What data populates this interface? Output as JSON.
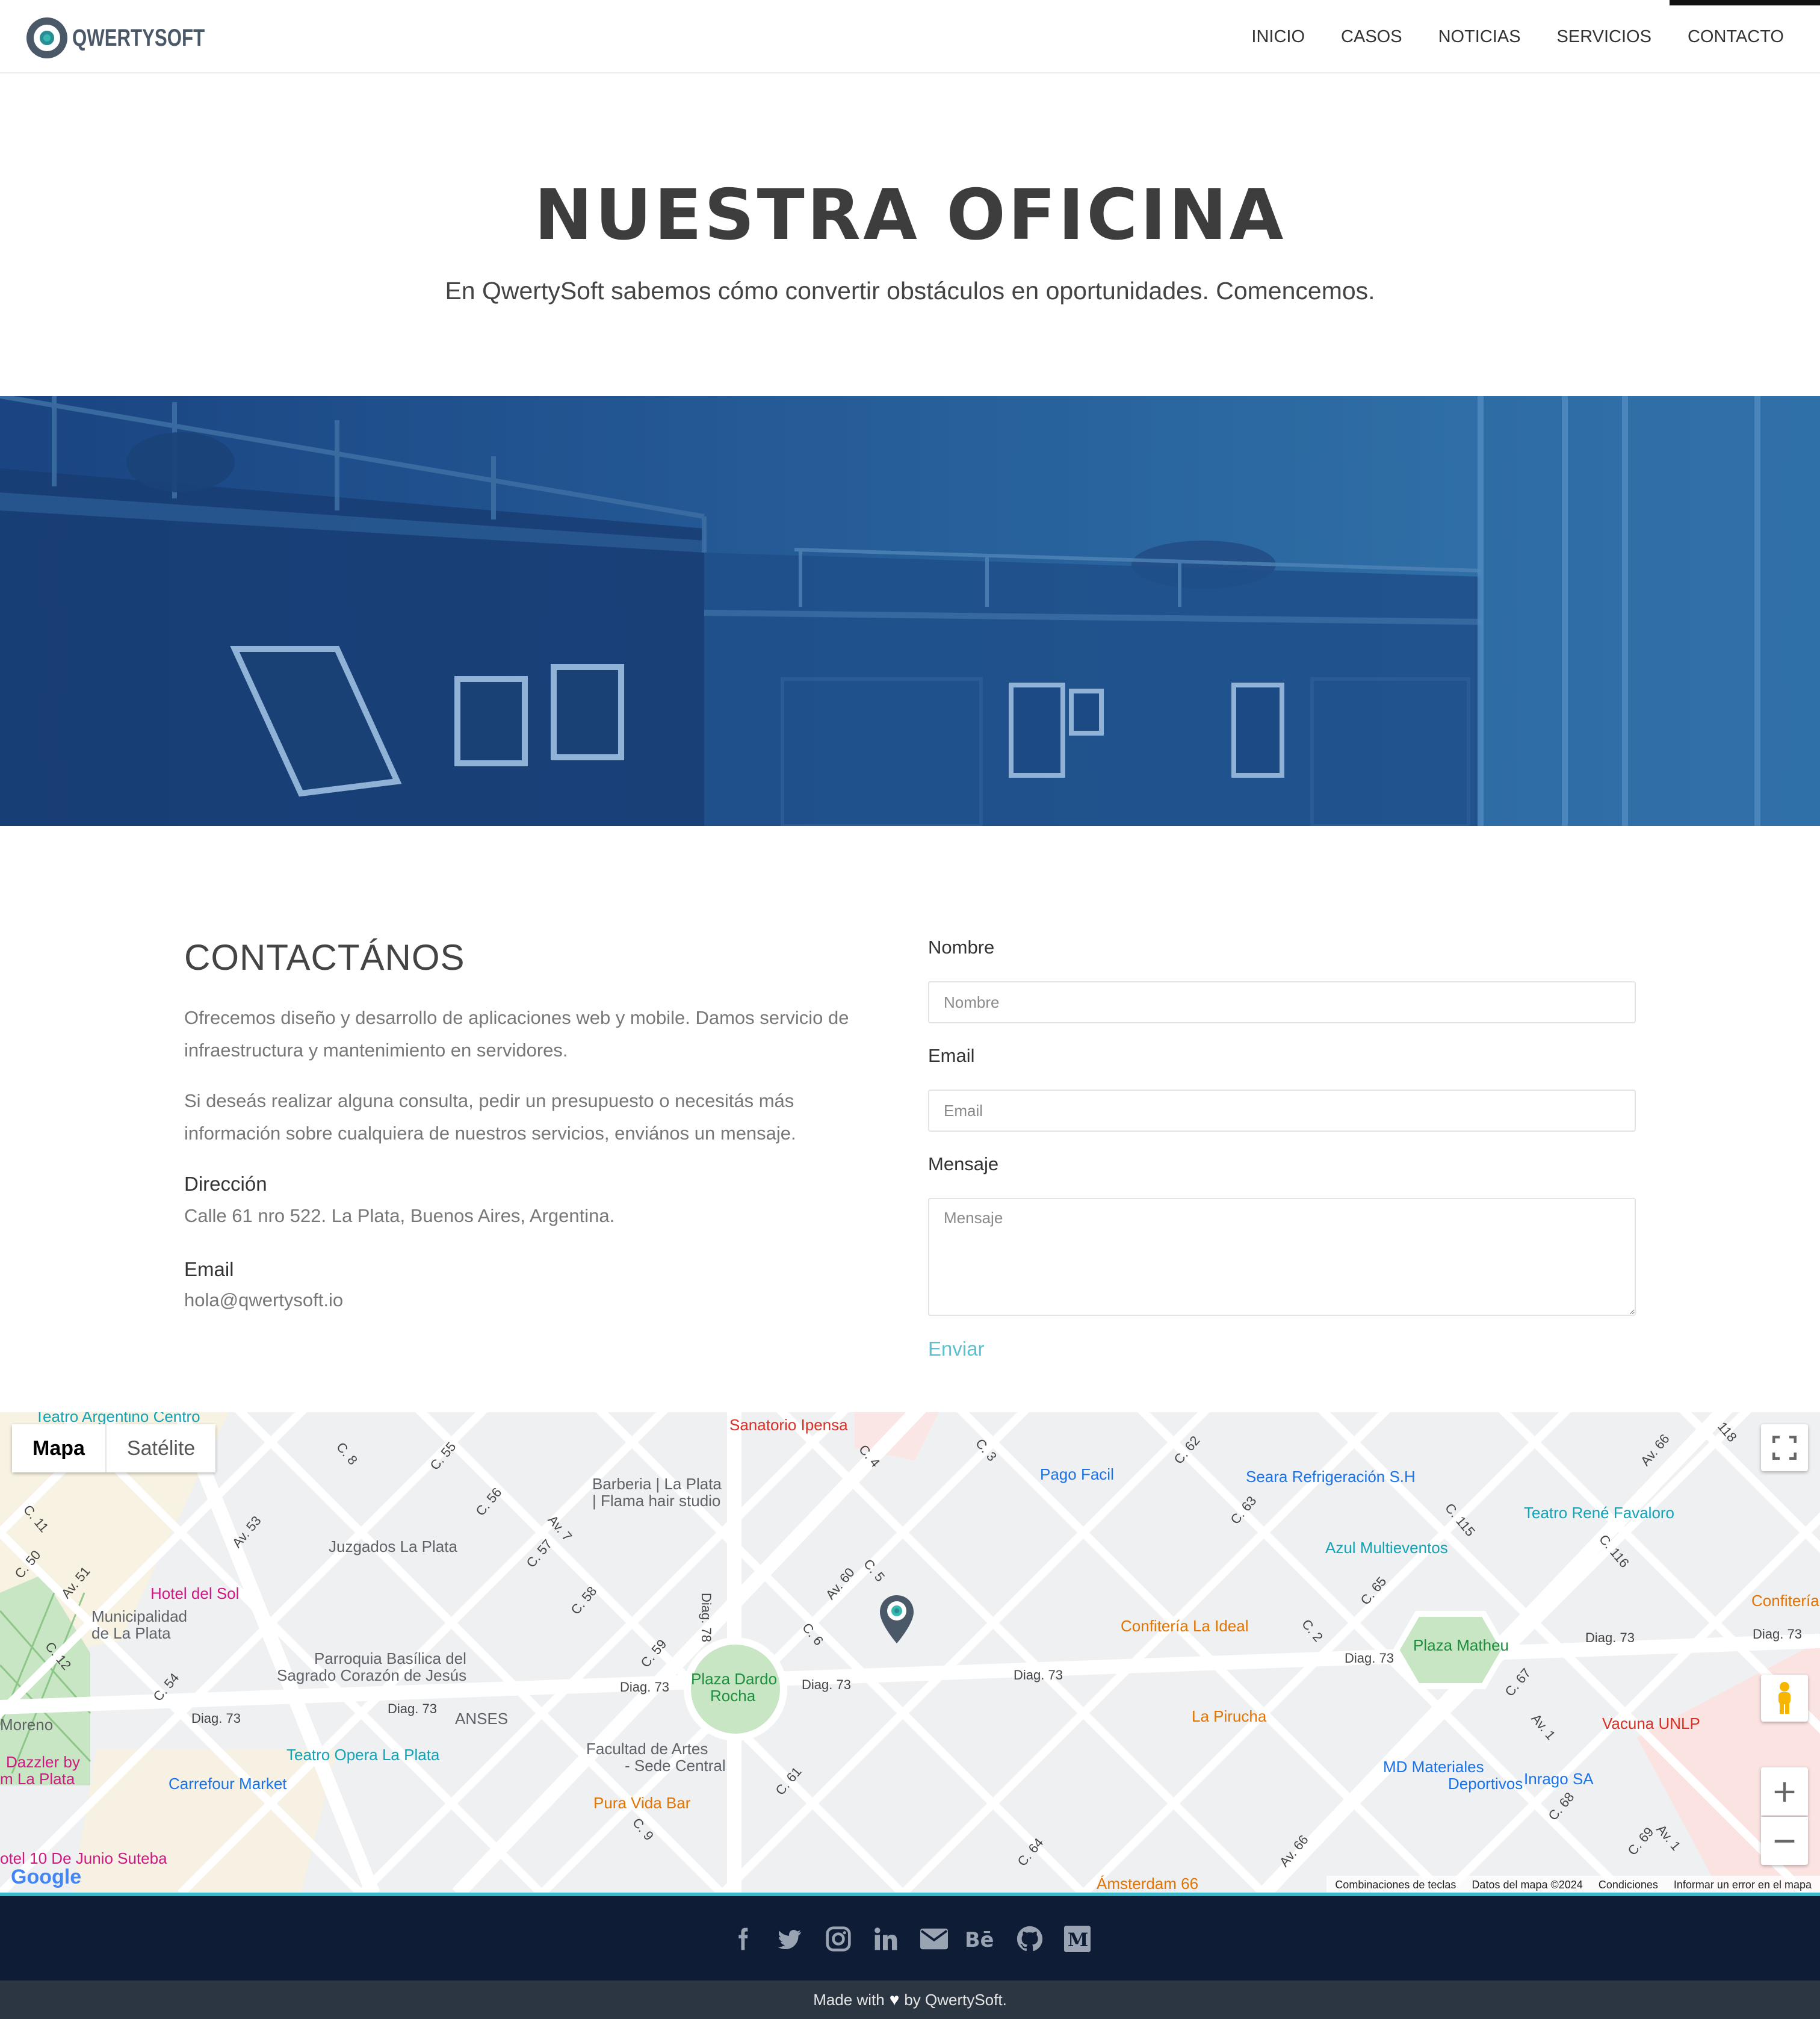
{
  "brand": {
    "name": "QWERTYSOFT"
  },
  "nav": {
    "items": [
      {
        "label": "INICIO"
      },
      {
        "label": "CASOS"
      },
      {
        "label": "NOTICIAS"
      },
      {
        "label": "SERVICIOS"
      },
      {
        "label": "CONTACTO",
        "active": true
      }
    ]
  },
  "hero": {
    "title": "NUESTRA OFICINA",
    "subtitle": "En QwertySoft sabemos cómo convertir obstáculos en oportunidades. Comencemos."
  },
  "contact": {
    "heading": "CONTACTÁNOS",
    "paragraph1": "Ofrecemos diseño y desarrollo de aplicaciones web y mobile. Damos servicio de infraestructura y mantenimiento en servidores.",
    "paragraph2": "Si deseás realizar alguna consulta, pedir un presupuesto o necesitás más información sobre cualquiera de nuestros servicios, enviános un mensaje.",
    "address_label": "Dirección",
    "address_value": "Calle 61 nro 522. La Plata, Buenos Aires, Argentina.",
    "email_label": "Email",
    "email_value": "hola@qwertysoft.io"
  },
  "form": {
    "name_label": "Nombre",
    "name_placeholder": "Nombre",
    "name_value": "",
    "email_label": "Email",
    "email_placeholder": "Email",
    "email_value": "",
    "message_label": "Mensaje",
    "message_placeholder": "Mensaje",
    "message_value": "",
    "submit_label": "Enviar"
  },
  "map": {
    "type_map": "Mapa",
    "type_satellite": "Satélite",
    "google": "Google",
    "footer": {
      "shortcuts": "Combinaciones de teclas",
      "data": "Datos del mapa ©2024",
      "terms": "Condiciones",
      "report": "Informar un error en el mapa"
    },
    "places": {
      "teatro_argentino": "Teatro Argentino Centro",
      "sanatorio": "Sanatorio Ipensa",
      "barberia": "Barberia | La Plata",
      "barberia2": "| Flama hair studio",
      "pago_facil": "Pago Facil",
      "seara": "Seara Refrigeración S.H",
      "teatro_rene": "Teatro René Favaloro",
      "juzgados": "Juzgados La Plata",
      "azul": "Azul Multieventos",
      "hotel_sol": "Hotel del Sol",
      "municipalidad": "Municipalidad",
      "municipalidad2": "de La Plata",
      "confiteria_ideal": "Confitería La Ideal",
      "confiteria": "Confitería",
      "plaza_matheu": "Plaza Matheu",
      "parroquia": "Parroquia Basílica del",
      "parroquia2": "Sagrado Corazón de Jesús",
      "plaza_dardo": "Plaza Dardo",
      "plaza_dardo2": "Rocha",
      "anses": "ANSES",
      "la_pirucha": "La Pirucha",
      "vacuna": "Vacuna UNLP",
      "moreno": "Moreno",
      "facultad": "Facultad de Artes",
      "facultad2": "- Sede Central",
      "dazzler": "Dazzler by",
      "dazzler2": "m La Plata",
      "teatro_opera": "Teatro Opera La Plata",
      "carrefour": "Carrefour Market",
      "md_materiales": "MD Materiales",
      "md_materiales2": "Deportivos",
      "inrago": "Inrago SA",
      "pura_vida": "Pura Vida Bar",
      "hotel_junio": "otel 10 De Junio Suteba",
      "amsterdam": "Ámsterdam 66"
    },
    "streets": {
      "diag73a": "Diag. 73",
      "diag73b": "Diag. 73",
      "diag73c": "Diag. 73",
      "diag73d": "Diag. 73",
      "diag73e": "Diag. 73",
      "diag73f": "Diag. 73",
      "diag73g": "Diag. 73",
      "diag73h": "Diag. 73",
      "diag78": "Diag. 78",
      "av60": "Av. 60",
      "av53": "Av. 53",
      "av51": "Av. 51",
      "av7": "Av. 7",
      "av66a": "Av. 66",
      "av66b": "Av. 66",
      "av1a": "Av. 1",
      "av1b": "Av. 1",
      "c4": "C. 4",
      "c3": "C. 3",
      "c62": "C. 62",
      "c63": "C. 63",
      "c8": "C. 8",
      "c55": "C. 55",
      "c56": "C. 56",
      "c57": "C. 57",
      "c58": "C. 58",
      "c59": "C. 59",
      "c6": "C. 6",
      "c5": "C. 5",
      "c2": "C. 2",
      "c65": "C. 65",
      "c67": "C. 67",
      "c68": "C. 68",
      "c69": "C. 69",
      "c115": "C. 115",
      "c116": "C. 116",
      "c118": "118",
      "c11": "C. 11",
      "c50": "C. 50",
      "c12": "C. 12",
      "c54": "C. 54",
      "c64": "C. 64",
      "c61": "C. 61",
      "c9": "C. 9"
    }
  },
  "footer": {
    "social": [
      {
        "icon": "facebook-icon"
      },
      {
        "icon": "twitter-icon"
      },
      {
        "icon": "instagram-icon"
      },
      {
        "icon": "linkedin-icon"
      },
      {
        "icon": "email-icon"
      },
      {
        "icon": "behance-icon"
      },
      {
        "icon": "github-icon"
      },
      {
        "icon": "medium-icon"
      }
    ],
    "made_with": "Made with",
    "by": "by QwertySoft."
  },
  "colors": {
    "accent": "#5bc0cf",
    "banner_blue": "#1f5594",
    "footer_dark": "#0e1c36",
    "footer_bottom": "#2c3542",
    "map_line": "#3bb8c9"
  }
}
